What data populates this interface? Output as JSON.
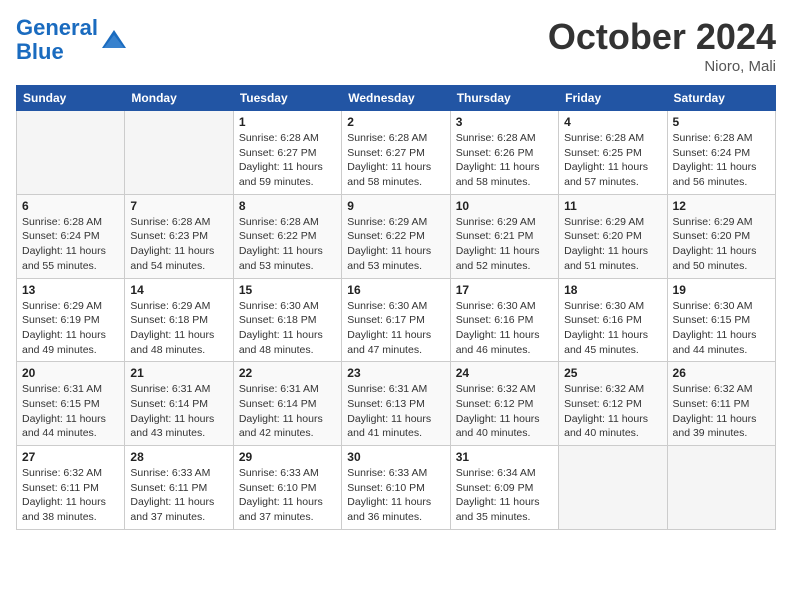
{
  "header": {
    "logo_line1": "General",
    "logo_line2": "Blue",
    "month_title": "October 2024",
    "location": "Nioro, Mali"
  },
  "days_of_week": [
    "Sunday",
    "Monday",
    "Tuesday",
    "Wednesday",
    "Thursday",
    "Friday",
    "Saturday"
  ],
  "weeks": [
    [
      {
        "day": "",
        "info": ""
      },
      {
        "day": "",
        "info": ""
      },
      {
        "day": "1",
        "info": "Sunrise: 6:28 AM\nSunset: 6:27 PM\nDaylight: 11 hours and 59 minutes."
      },
      {
        "day": "2",
        "info": "Sunrise: 6:28 AM\nSunset: 6:27 PM\nDaylight: 11 hours and 58 minutes."
      },
      {
        "day": "3",
        "info": "Sunrise: 6:28 AM\nSunset: 6:26 PM\nDaylight: 11 hours and 58 minutes."
      },
      {
        "day": "4",
        "info": "Sunrise: 6:28 AM\nSunset: 6:25 PM\nDaylight: 11 hours and 57 minutes."
      },
      {
        "day": "5",
        "info": "Sunrise: 6:28 AM\nSunset: 6:24 PM\nDaylight: 11 hours and 56 minutes."
      }
    ],
    [
      {
        "day": "6",
        "info": "Sunrise: 6:28 AM\nSunset: 6:24 PM\nDaylight: 11 hours and 55 minutes."
      },
      {
        "day": "7",
        "info": "Sunrise: 6:28 AM\nSunset: 6:23 PM\nDaylight: 11 hours and 54 minutes."
      },
      {
        "day": "8",
        "info": "Sunrise: 6:28 AM\nSunset: 6:22 PM\nDaylight: 11 hours and 53 minutes."
      },
      {
        "day": "9",
        "info": "Sunrise: 6:29 AM\nSunset: 6:22 PM\nDaylight: 11 hours and 53 minutes."
      },
      {
        "day": "10",
        "info": "Sunrise: 6:29 AM\nSunset: 6:21 PM\nDaylight: 11 hours and 52 minutes."
      },
      {
        "day": "11",
        "info": "Sunrise: 6:29 AM\nSunset: 6:20 PM\nDaylight: 11 hours and 51 minutes."
      },
      {
        "day": "12",
        "info": "Sunrise: 6:29 AM\nSunset: 6:20 PM\nDaylight: 11 hours and 50 minutes."
      }
    ],
    [
      {
        "day": "13",
        "info": "Sunrise: 6:29 AM\nSunset: 6:19 PM\nDaylight: 11 hours and 49 minutes."
      },
      {
        "day": "14",
        "info": "Sunrise: 6:29 AM\nSunset: 6:18 PM\nDaylight: 11 hours and 48 minutes."
      },
      {
        "day": "15",
        "info": "Sunrise: 6:30 AM\nSunset: 6:18 PM\nDaylight: 11 hours and 48 minutes."
      },
      {
        "day": "16",
        "info": "Sunrise: 6:30 AM\nSunset: 6:17 PM\nDaylight: 11 hours and 47 minutes."
      },
      {
        "day": "17",
        "info": "Sunrise: 6:30 AM\nSunset: 6:16 PM\nDaylight: 11 hours and 46 minutes."
      },
      {
        "day": "18",
        "info": "Sunrise: 6:30 AM\nSunset: 6:16 PM\nDaylight: 11 hours and 45 minutes."
      },
      {
        "day": "19",
        "info": "Sunrise: 6:30 AM\nSunset: 6:15 PM\nDaylight: 11 hours and 44 minutes."
      }
    ],
    [
      {
        "day": "20",
        "info": "Sunrise: 6:31 AM\nSunset: 6:15 PM\nDaylight: 11 hours and 44 minutes."
      },
      {
        "day": "21",
        "info": "Sunrise: 6:31 AM\nSunset: 6:14 PM\nDaylight: 11 hours and 43 minutes."
      },
      {
        "day": "22",
        "info": "Sunrise: 6:31 AM\nSunset: 6:14 PM\nDaylight: 11 hours and 42 minutes."
      },
      {
        "day": "23",
        "info": "Sunrise: 6:31 AM\nSunset: 6:13 PM\nDaylight: 11 hours and 41 minutes."
      },
      {
        "day": "24",
        "info": "Sunrise: 6:32 AM\nSunset: 6:12 PM\nDaylight: 11 hours and 40 minutes."
      },
      {
        "day": "25",
        "info": "Sunrise: 6:32 AM\nSunset: 6:12 PM\nDaylight: 11 hours and 40 minutes."
      },
      {
        "day": "26",
        "info": "Sunrise: 6:32 AM\nSunset: 6:11 PM\nDaylight: 11 hours and 39 minutes."
      }
    ],
    [
      {
        "day": "27",
        "info": "Sunrise: 6:32 AM\nSunset: 6:11 PM\nDaylight: 11 hours and 38 minutes."
      },
      {
        "day": "28",
        "info": "Sunrise: 6:33 AM\nSunset: 6:11 PM\nDaylight: 11 hours and 37 minutes."
      },
      {
        "day": "29",
        "info": "Sunrise: 6:33 AM\nSunset: 6:10 PM\nDaylight: 11 hours and 37 minutes."
      },
      {
        "day": "30",
        "info": "Sunrise: 6:33 AM\nSunset: 6:10 PM\nDaylight: 11 hours and 36 minutes."
      },
      {
        "day": "31",
        "info": "Sunrise: 6:34 AM\nSunset: 6:09 PM\nDaylight: 11 hours and 35 minutes."
      },
      {
        "day": "",
        "info": ""
      },
      {
        "day": "",
        "info": ""
      }
    ]
  ]
}
